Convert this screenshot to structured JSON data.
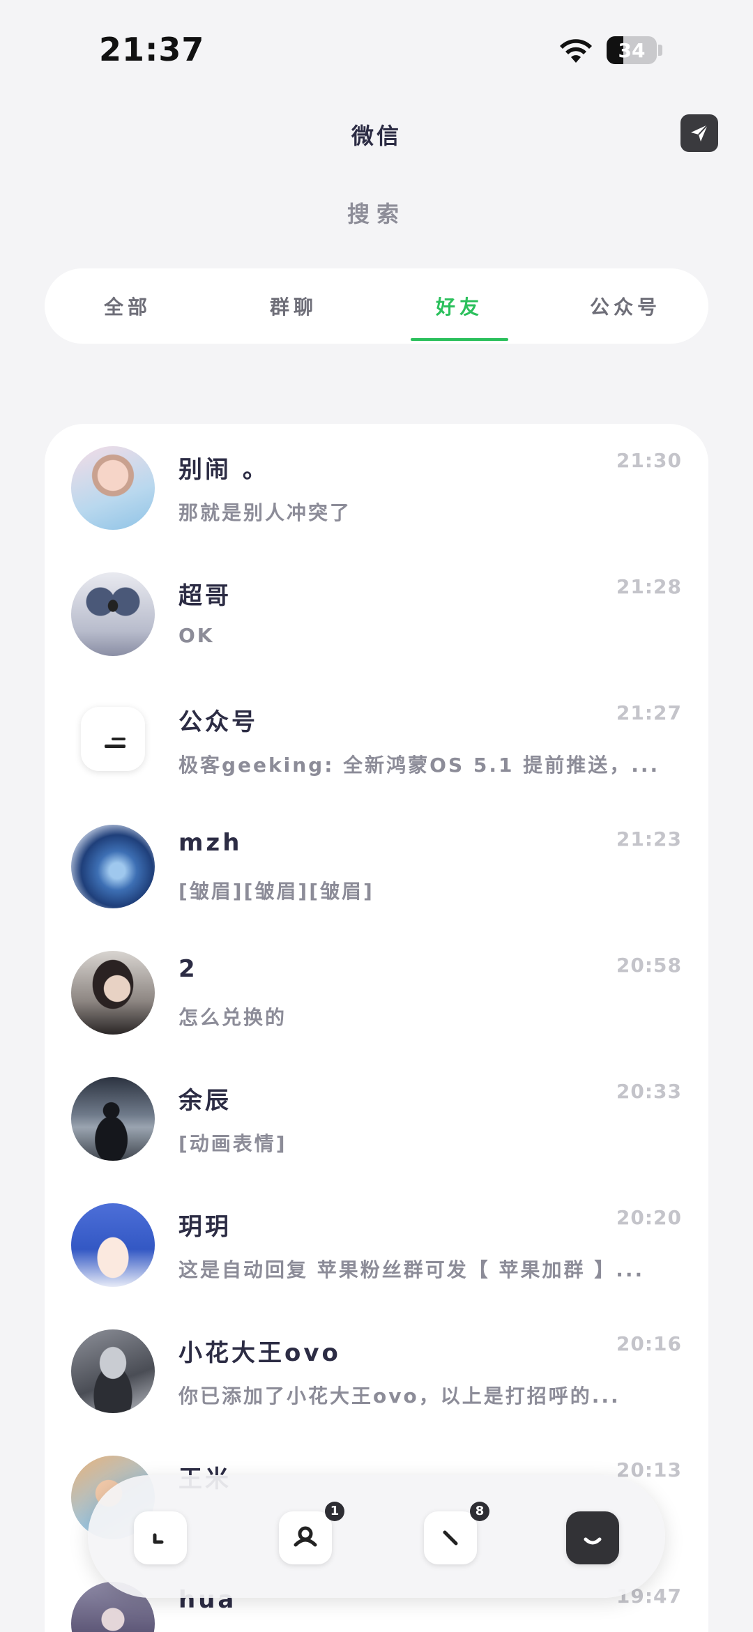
{
  "status_bar": {
    "time": "21:37",
    "battery": "34",
    "battery_level": 0.34
  },
  "header": {
    "title": "微信",
    "search_label": "搜索",
    "send_icon": "send-icon"
  },
  "tabs": [
    {
      "label": "全部",
      "active": false
    },
    {
      "label": "群聊",
      "active": false
    },
    {
      "label": "好友",
      "active": true
    },
    {
      "label": "公众号",
      "active": false
    }
  ],
  "colors": {
    "accent": "#2bc05c",
    "text": "#2c2c44",
    "muted": "#8c8c98",
    "time": "#c4c4ca"
  },
  "chats": [
    {
      "name": "别闹 。",
      "message": "那就是别人冲突了",
      "time": "21:30"
    },
    {
      "name": "超哥",
      "message": "OK",
      "time": "21:28"
    },
    {
      "name": "公众号",
      "message": "极客geeking: 全新鸿蒙OS 5.1 提前推送，...",
      "time": "21:27"
    },
    {
      "name": "mzh",
      "message": "[皱眉][皱眉][皱眉]",
      "time": "21:23"
    },
    {
      "name": "2",
      "message": "怎么兑换的",
      "time": "20:58"
    },
    {
      "name": "余辰",
      "message": "[动画表情]",
      "time": "20:33"
    },
    {
      "name": "玥玥",
      "message": "这是自动回复 苹果粉丝群可发【 苹果加群 】...",
      "time": "20:20"
    },
    {
      "name": "小花大王ovo",
      "message": "你已添加了小花大王ovo，以上是打招呼的...",
      "time": "20:16"
    },
    {
      "name": "王米",
      "message": "",
      "time": "20:13"
    },
    {
      "name": "hua",
      "message": "",
      "time": "19:47"
    }
  ],
  "bottom_nav": [
    {
      "icon": "chat-icon",
      "badge": "",
      "active": false
    },
    {
      "icon": "contacts-icon",
      "badge": "1",
      "active": false
    },
    {
      "icon": "discover-icon",
      "badge": "8",
      "active": false
    },
    {
      "icon": "me-icon",
      "badge": "",
      "active": true
    }
  ]
}
